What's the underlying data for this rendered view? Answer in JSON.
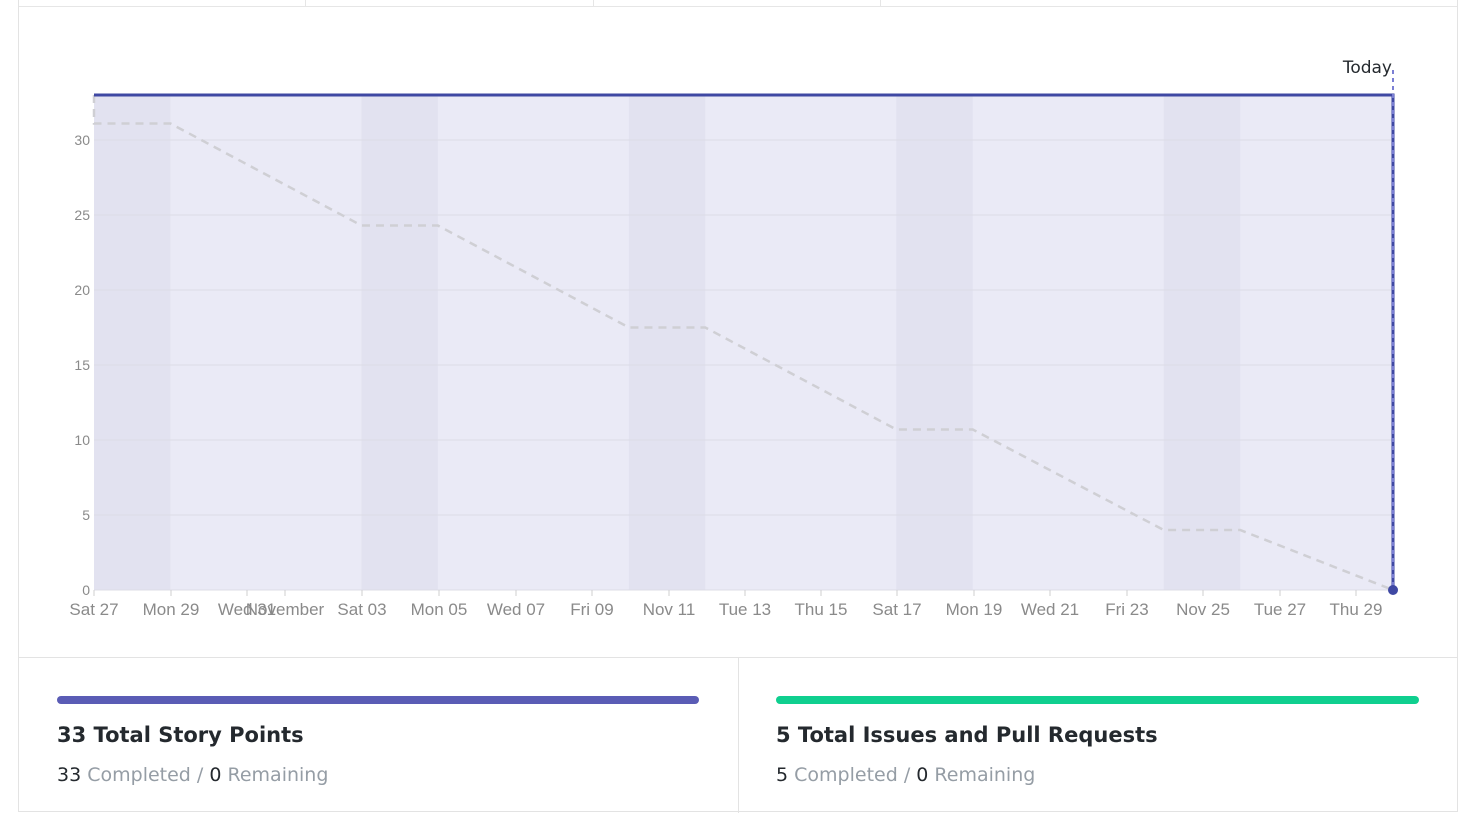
{
  "chart_data": {
    "type": "line",
    "today_label": "Today",
    "yticks": [
      0,
      5,
      10,
      15,
      20,
      25,
      30
    ],
    "ylim": [
      0,
      33
    ],
    "x_tick_labels": [
      "Sat 27",
      "Mon 29",
      "Wed 31",
      "November",
      "Sat 03",
      "Mon 05",
      "Wed 07",
      "Fri 09",
      "Nov 11",
      "Tue 13",
      "Thu 15",
      "Sat 17",
      "Mon 19",
      "Wed 21",
      "Fri 23",
      "Nov 25",
      "Tue 27",
      "Thu 29"
    ],
    "xlim": [
      "2018-10-27",
      "2018-11-30"
    ],
    "weekend_bands": [
      [
        "2018-10-27",
        "2018-10-29"
      ],
      [
        "2018-11-03",
        "2018-11-05"
      ],
      [
        "2018-11-10",
        "2018-11-12"
      ],
      [
        "2018-11-17",
        "2018-11-19"
      ],
      [
        "2018-11-24",
        "2018-11-26"
      ]
    ],
    "series": [
      {
        "style": "solid",
        "color": "#3f48a3",
        "fill": "#eaeaf6",
        "points": [
          {
            "x": "2018-10-27",
            "y": 33
          },
          {
            "x": "2018-11-30",
            "y": 33
          },
          {
            "x": "2018-11-30",
            "y": 0
          }
        ]
      },
      {
        "style": "dashed",
        "color": "#cfcfd4",
        "points": [
          {
            "x": "2018-10-27",
            "y": 33
          },
          {
            "x": "2018-10-27",
            "y": 31.1
          },
          {
            "x": "2018-10-29",
            "y": 31.1
          },
          {
            "x": "2018-11-03",
            "y": 24.3
          },
          {
            "x": "2018-11-05",
            "y": 24.3
          },
          {
            "x": "2018-11-10",
            "y": 17.5
          },
          {
            "x": "2018-11-12",
            "y": 17.5
          },
          {
            "x": "2018-11-17",
            "y": 10.7
          },
          {
            "x": "2018-11-19",
            "y": 10.7
          },
          {
            "x": "2018-11-24",
            "y": 4.0
          },
          {
            "x": "2018-11-26",
            "y": 4.0
          },
          {
            "x": "2018-11-30",
            "y": 0
          }
        ]
      }
    ],
    "endpoint": {
      "x": "2018-11-30",
      "y": 0
    }
  },
  "stats": {
    "story_points": {
      "title": "33 Total Story Points",
      "completed_value": "33",
      "completed_label": "Completed",
      "separator": "/",
      "remaining_value": "0",
      "remaining_label": "Remaining",
      "bar_color": "#5a5cb5",
      "progress": 1.0
    },
    "issues": {
      "title": "5 Total Issues and Pull Requests",
      "completed_value": "5",
      "completed_label": "Completed",
      "separator": "/",
      "remaining_value": "0",
      "remaining_label": "Remaining",
      "bar_color": "#0fcf8f",
      "progress": 1.0
    }
  }
}
